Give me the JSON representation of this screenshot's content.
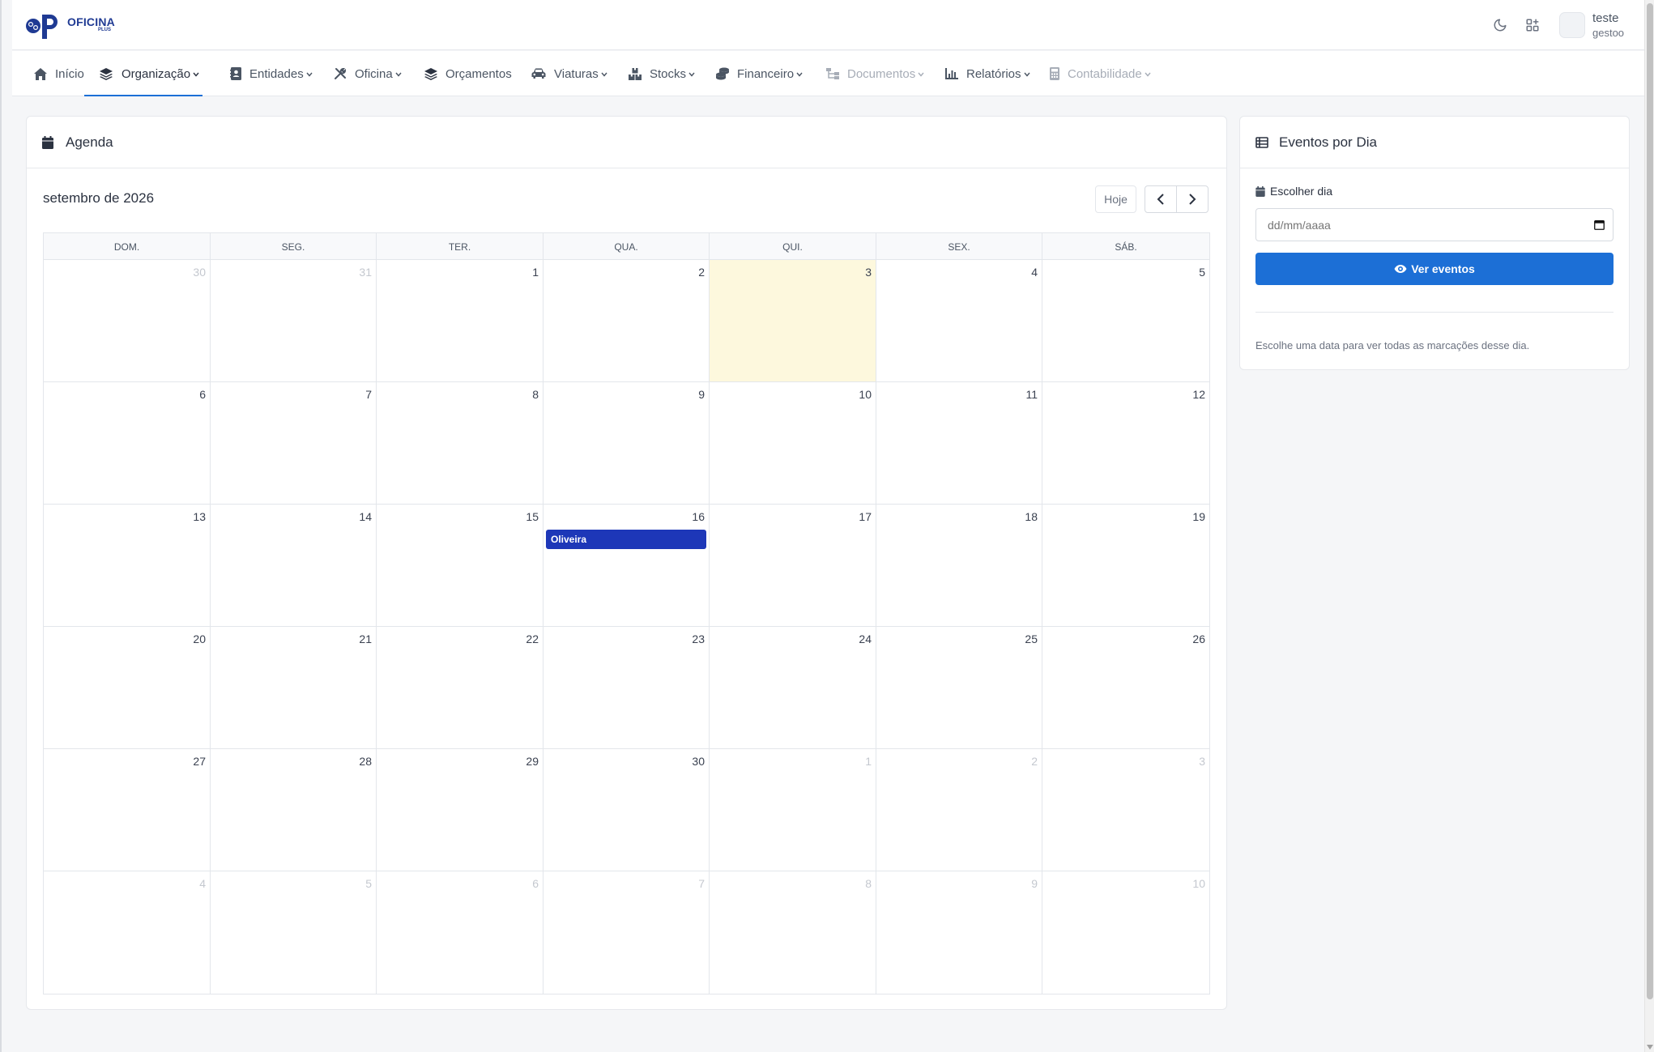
{
  "app": {
    "logo_text": "OFICINA",
    "logo_sub": "PLUS",
    "colors": {
      "brand": "#1f3a93",
      "accent": "#1c6fd6",
      "event": "#1d37b8",
      "today": "#fdf8dd"
    }
  },
  "topbar": {
    "icons": [
      "moon-icon",
      "apps-add-icon"
    ],
    "user": {
      "name": "teste",
      "role": "gestoo"
    }
  },
  "nav": {
    "items": [
      {
        "label": "Início",
        "icon": "home-icon",
        "dropdown": false,
        "active": false,
        "disabled": false
      },
      {
        "label": "Organização",
        "icon": "layers-icon",
        "dropdown": true,
        "active": true,
        "disabled": false
      },
      {
        "label": "Entidades",
        "icon": "contact-card-icon",
        "dropdown": true,
        "active": false,
        "disabled": false
      },
      {
        "label": "Oficina",
        "icon": "tools-icon",
        "dropdown": true,
        "active": false,
        "disabled": false
      },
      {
        "label": "Orçamentos",
        "icon": "layers-icon",
        "dropdown": false,
        "active": false,
        "disabled": false
      },
      {
        "label": "Viaturas",
        "icon": "car-icon",
        "dropdown": true,
        "active": false,
        "disabled": false
      },
      {
        "label": "Stocks",
        "icon": "boxes-icon",
        "dropdown": true,
        "active": false,
        "disabled": false
      },
      {
        "label": "Financeiro",
        "icon": "coins-icon",
        "dropdown": true,
        "active": false,
        "disabled": false
      },
      {
        "label": "Documentos",
        "icon": "sitemap-icon",
        "dropdown": true,
        "active": false,
        "disabled": true
      },
      {
        "label": "Relatórios",
        "icon": "chart-icon",
        "dropdown": true,
        "active": false,
        "disabled": false
      },
      {
        "label": "Contabilidade",
        "icon": "calculator-icon",
        "dropdown": true,
        "active": false,
        "disabled": true
      }
    ]
  },
  "agenda": {
    "title": "Agenda",
    "month_label": "setembro de 2026",
    "today_button": "Hoje",
    "weekdays": [
      "DOM.",
      "SEG.",
      "TER.",
      "QUA.",
      "QUI.",
      "SEX.",
      "SÁB."
    ],
    "weeks": [
      [
        {
          "d": "30",
          "m": true
        },
        {
          "d": "31",
          "m": true
        },
        {
          "d": "1"
        },
        {
          "d": "2"
        },
        {
          "d": "3",
          "today": true
        },
        {
          "d": "4"
        },
        {
          "d": "5"
        }
      ],
      [
        {
          "d": "6"
        },
        {
          "d": "7"
        },
        {
          "d": "8"
        },
        {
          "d": "9"
        },
        {
          "d": "10"
        },
        {
          "d": "11"
        },
        {
          "d": "12"
        }
      ],
      [
        {
          "d": "13"
        },
        {
          "d": "14"
        },
        {
          "d": "15"
        },
        {
          "d": "16",
          "event": "Oliveira"
        },
        {
          "d": "17"
        },
        {
          "d": "18"
        },
        {
          "d": "19"
        }
      ],
      [
        {
          "d": "20"
        },
        {
          "d": "21"
        },
        {
          "d": "22"
        },
        {
          "d": "23"
        },
        {
          "d": "24"
        },
        {
          "d": "25"
        },
        {
          "d": "26"
        }
      ],
      [
        {
          "d": "27"
        },
        {
          "d": "28"
        },
        {
          "d": "29"
        },
        {
          "d": "30"
        },
        {
          "d": "1",
          "m": true
        },
        {
          "d": "2",
          "m": true
        },
        {
          "d": "3",
          "m": true
        }
      ],
      [
        {
          "d": "4",
          "m": true
        },
        {
          "d": "5",
          "m": true
        },
        {
          "d": "6",
          "m": true
        },
        {
          "d": "7",
          "m": true
        },
        {
          "d": "8",
          "m": true
        },
        {
          "d": "9",
          "m": true
        },
        {
          "d": "10",
          "m": true
        }
      ]
    ]
  },
  "events_panel": {
    "title": "Eventos por Dia",
    "choose_label": "Escolher dia",
    "date_placeholder": "dd/mm/aaaa",
    "view_button": "Ver eventos",
    "hint": "Escolhe uma data para ver todas as marcações desse dia."
  }
}
